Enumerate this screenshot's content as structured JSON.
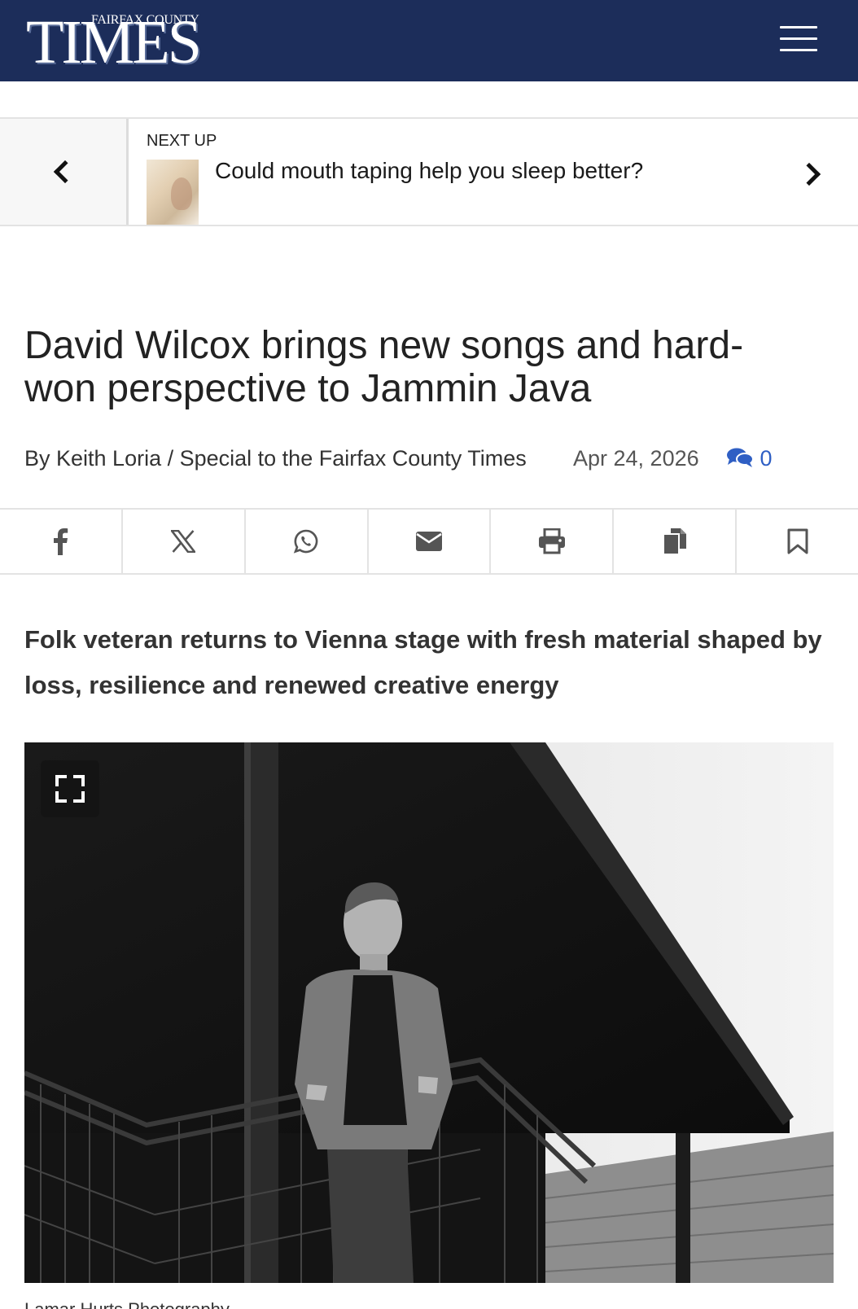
{
  "header": {
    "logo_small": "FAIRFAX COUNTY",
    "logo_big": "TIMES",
    "menu_icon": "hamburger-menu-icon",
    "colors": {
      "header_bg": "#1c2d5a",
      "link": "#2f5fc4"
    }
  },
  "next_up": {
    "label": "NEXT UP",
    "title": "Could mouth taping help you sleep better?",
    "prev_icon": "chevron-left-icon",
    "next_icon": "chevron-right-icon"
  },
  "article": {
    "headline": "David Wilcox brings new songs and hard-won perspective to Jammin Java",
    "byline": "By Keith Loria / Special to the Fairfax County Times",
    "date": "Apr 24, 2026",
    "comment_count": "0",
    "subhead": "Folk veteran returns to Vienna stage with fresh material shaped by loss, resilience and renewed creative energy",
    "caption": "Lamar Hurts Photography"
  },
  "share_bar": {
    "buttons": [
      "facebook-icon",
      "x-icon",
      "whatsapp-icon",
      "email-icon",
      "print-icon",
      "copy-icon",
      "bookmark-icon"
    ]
  },
  "photo": {
    "description_icon": "expand-icon"
  }
}
